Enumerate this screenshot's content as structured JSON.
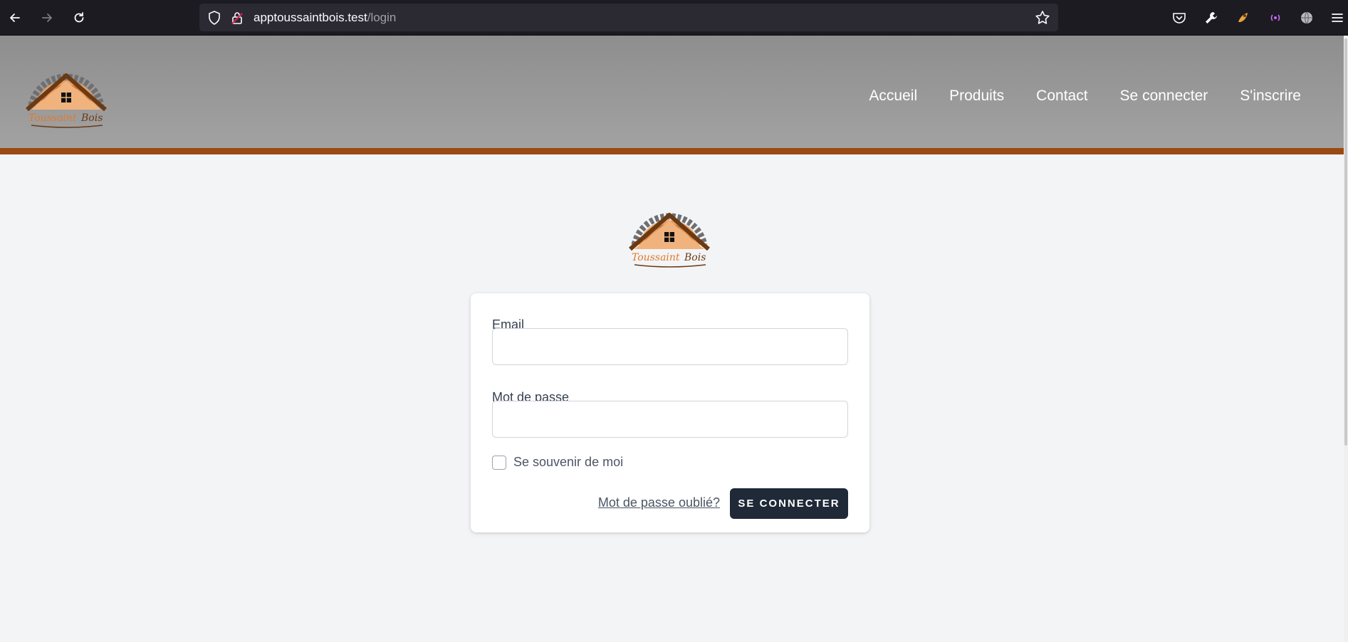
{
  "browser": {
    "url_host": "apptoussaintbois.test",
    "url_path": "/login",
    "icons": [
      "back-icon",
      "forward-icon",
      "reload-icon",
      "shield-icon",
      "lock-icon",
      "bookmark-star-icon",
      "pocket-icon",
      "wrench-icon",
      "extension-icon",
      "broadcast-icon",
      "globe-icon",
      "menu-icon"
    ]
  },
  "header": {
    "logo_text": "Toussaint Bois",
    "nav": [
      {
        "label": "Accueil"
      },
      {
        "label": "Produits"
      },
      {
        "label": "Contact"
      },
      {
        "label": "Se connecter"
      },
      {
        "label": "S'inscrire"
      }
    ]
  },
  "login": {
    "email_label": "Email",
    "email_value": "",
    "password_label": "Mot de passe",
    "password_value": "",
    "remember_label": "Se souvenir de moi",
    "remember_checked": false,
    "forgot_link": "Mot de passe oublié?",
    "submit_label": "SE CONNECTER"
  },
  "colors": {
    "header_bg": "#8e8e8f",
    "accent": "#9a4a12",
    "button_bg": "#1f2937",
    "page_bg": "#f3f4f6"
  }
}
